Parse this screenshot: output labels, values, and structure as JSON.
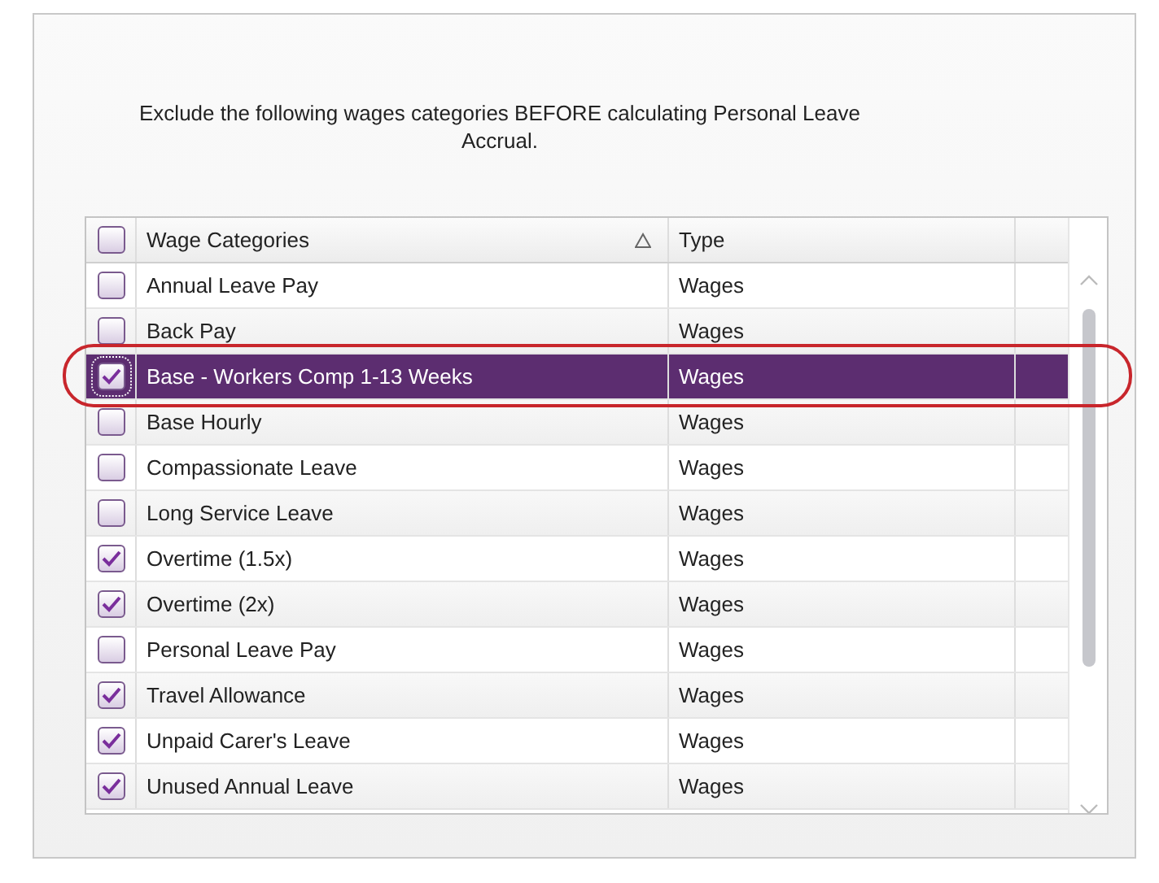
{
  "instruction": "Exclude the following wages categories BEFORE calculating Personal Leave Accrual.",
  "table": {
    "header_checkbox": {
      "checked": false
    },
    "columns": [
      {
        "label": "Wage Categories",
        "sorted": true
      },
      {
        "label": "Type",
        "sorted": false
      }
    ],
    "rows": [
      {
        "category": "Annual Leave Pay",
        "type": "Wages",
        "checked": false,
        "selected": false
      },
      {
        "category": "Back Pay",
        "type": "Wages",
        "checked": false,
        "selected": false
      },
      {
        "category": "Base - Workers Comp 1-13 Weeks",
        "type": "Wages",
        "checked": true,
        "selected": true,
        "circled": true
      },
      {
        "category": "Base Hourly",
        "type": "Wages",
        "checked": false,
        "selected": false
      },
      {
        "category": "Compassionate Leave",
        "type": "Wages",
        "checked": false,
        "selected": false
      },
      {
        "category": "Long Service Leave",
        "type": "Wages",
        "checked": false,
        "selected": false
      },
      {
        "category": "Overtime (1.5x)",
        "type": "Wages",
        "checked": true,
        "selected": false
      },
      {
        "category": "Overtime (2x)",
        "type": "Wages",
        "checked": true,
        "selected": false
      },
      {
        "category": "Personal Leave Pay",
        "type": "Wages",
        "checked": false,
        "selected": false
      },
      {
        "category": "Travel Allowance",
        "type": "Wages",
        "checked": true,
        "selected": false
      },
      {
        "category": "Unpaid Carer's Leave",
        "type": "Wages",
        "checked": true,
        "selected": false
      },
      {
        "category": "Unused Annual Leave",
        "type": "Wages",
        "checked": true,
        "selected": false
      }
    ]
  }
}
